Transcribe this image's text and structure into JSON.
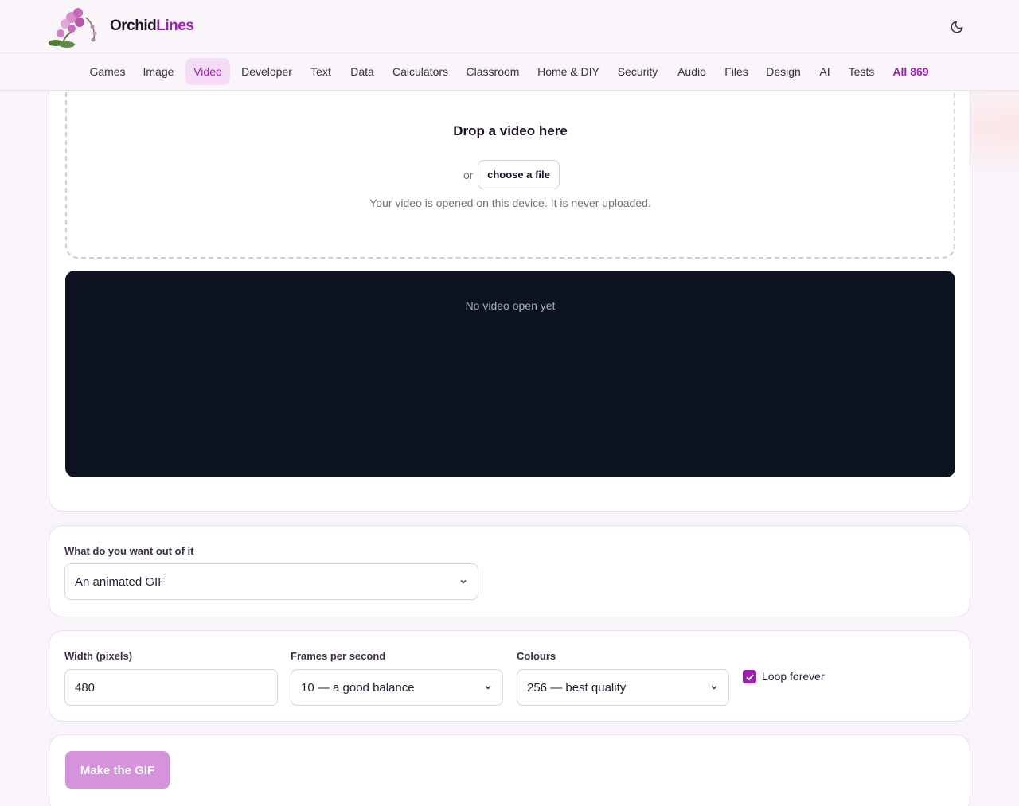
{
  "brand": {
    "part1": "Orchid",
    "part2": "Lines"
  },
  "nav": {
    "items": [
      {
        "label": "Games"
      },
      {
        "label": "Image"
      },
      {
        "label": "Video"
      },
      {
        "label": "Developer"
      },
      {
        "label": "Text"
      },
      {
        "label": "Data"
      },
      {
        "label": "Calculators"
      },
      {
        "label": "Classroom"
      },
      {
        "label": "Home & DIY"
      },
      {
        "label": "Security"
      },
      {
        "label": "Audio"
      },
      {
        "label": "Files"
      },
      {
        "label": "Design"
      },
      {
        "label": "AI"
      },
      {
        "label": "Tests"
      },
      {
        "label": "All 869"
      }
    ],
    "active": "Video"
  },
  "upload": {
    "title": "Drop a video here",
    "or": "or",
    "choose_label": "choose a file",
    "note": "Your video is opened on this device. It is never uploaded.",
    "player_empty": "No video open yet"
  },
  "output": {
    "label": "What do you want out of it",
    "value": "An animated GIF"
  },
  "settings": {
    "width_label": "Width (pixels)",
    "width_value": "480",
    "fps_label": "Frames per second",
    "fps_value": "10 — a good balance",
    "colours_label": "Colours",
    "colours_value": "256 — best quality",
    "loop_label": "Loop forever",
    "loop_checked": true
  },
  "action": {
    "make_label": "Make the GIF"
  },
  "colors": {
    "accent": "#9b1fb0",
    "button": "#d493da",
    "player_bg": "#0d1220"
  }
}
